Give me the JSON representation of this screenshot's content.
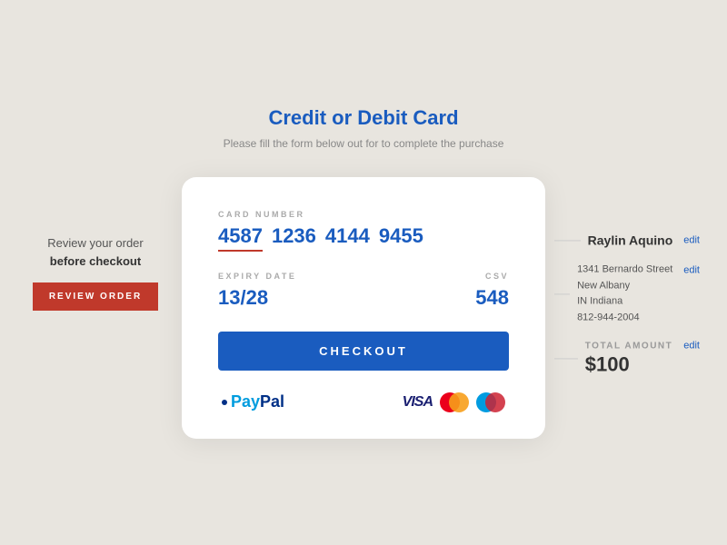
{
  "page": {
    "background_color": "#e8e5df"
  },
  "left_panel": {
    "review_text_line1": "Review your order",
    "review_text_line2": "before checkout",
    "review_button_label": "REVIEW ORDER"
  },
  "center": {
    "title": "Credit or Debit Card",
    "subtitle": "Please fill the form below out for to complete the purchase",
    "card_number_label": "CARD NUMBER",
    "card_segments": [
      "4587",
      "1236",
      "4144",
      "9455"
    ],
    "expiry_label": "EXPIRY DATE",
    "expiry_value": "13/28",
    "csv_label": "CSV",
    "csv_value": "548",
    "checkout_button": "CHECKOUT"
  },
  "payment_icons": {
    "paypal_label": "PayPal"
  },
  "right_panel": {
    "user_name": "Raylin Aquino",
    "edit_label1": "edit",
    "address_street": "1341  Bernardo Street",
    "edit_label2": "edit",
    "address_city": "New Albany",
    "address_state": "IN Indiana",
    "address_phone": "812-944-2004",
    "total_label": "TOTAL AMOUNT",
    "edit_label3": "edit",
    "total_amount": "$100"
  }
}
